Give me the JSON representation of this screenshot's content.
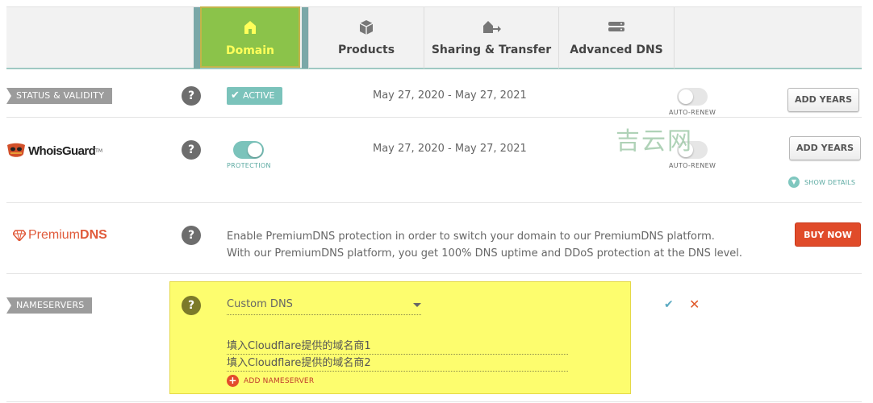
{
  "tabs": [
    {
      "label": "Domain",
      "icon": "home-icon",
      "active": true
    },
    {
      "label": "Products",
      "icon": "box-icon",
      "active": false
    },
    {
      "label": "Sharing & Transfer",
      "icon": "share-transfer-icon",
      "active": false
    },
    {
      "label": "Advanced DNS",
      "icon": "dns-servers-icon",
      "active": false
    }
  ],
  "status": {
    "tag": "STATUS & VALIDITY",
    "help": "?",
    "badge": "ACTIVE",
    "dates": "May 27, 2020 - May 27, 2021",
    "auto_renew_label": "AUTO-RENEW",
    "auto_renew_on": false,
    "add_years": "ADD YEARS"
  },
  "whoisguard": {
    "logo_text": "WhoisGuard",
    "logo_tm": "TM",
    "help": "?",
    "protection_label": "PROTECTION",
    "protection_on": true,
    "dates": "May 27, 2020 - May 27, 2021",
    "auto_renew_label": "AUTO-RENEW",
    "auto_renew_on": false,
    "add_years": "ADD YEARS",
    "show_details": "SHOW DETAILS"
  },
  "premiumdns": {
    "logo_a": "Premium",
    "logo_b": "DNS",
    "help": "?",
    "line1": "Enable PremiumDNS protection in order to switch your domain to our PremiumDNS platform.",
    "line2": "With our PremiumDNS platform, you get 100% DNS uptime and DDoS protection at the DNS level.",
    "buy_now": "BUY NOW"
  },
  "nameservers": {
    "tag": "NAMESERVERS",
    "help": "?",
    "selected": "Custom DNS",
    "ns1": "填入Cloudflare提供的域名商1",
    "ns2": "填入Cloudflare提供的域名商2",
    "add_label": "ADD NAMESERVER"
  },
  "watermark": "吉云网",
  "colors": {
    "active_tab": "#8bc34a",
    "active_tab_text": "#ffff5a",
    "teal": "#7bc3bb",
    "highlight": "#fdfd6e",
    "buy_red": "#e04b2a"
  }
}
